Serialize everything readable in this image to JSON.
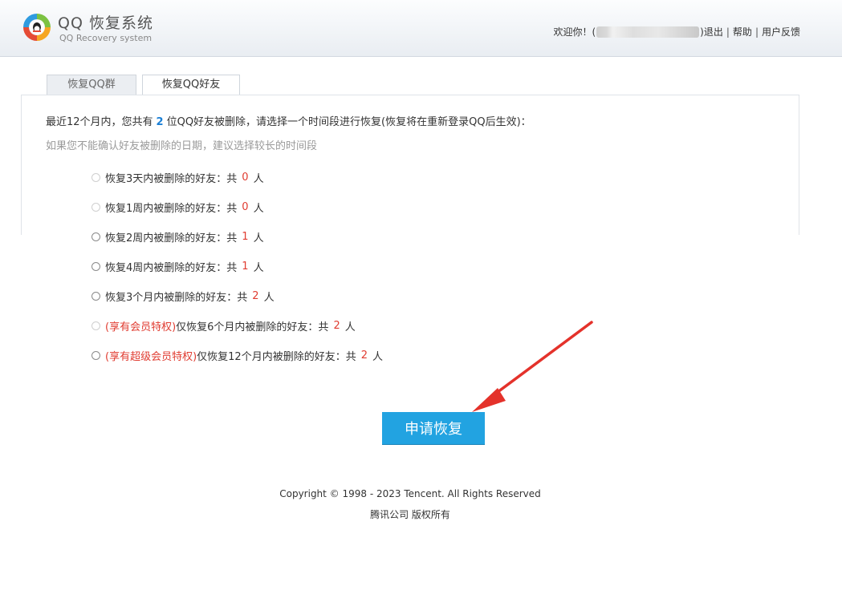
{
  "header": {
    "logo_title": "QQ 恢复系统",
    "logo_subtitle": "QQ Recovery system",
    "welcome": "欢迎你！(",
    "close_paren": ")",
    "logout": "退出",
    "help": "帮助",
    "feedback": "用户反馈",
    "sep": "|"
  },
  "tabs": [
    {
      "label": "恢复QQ群"
    },
    {
      "label": "恢复QQ好友"
    }
  ],
  "summary": {
    "prefix": "最近12个月内，您共有",
    "count": "2",
    "suffix": "位QQ好友被删除，请选择一个时间段进行恢复(恢复将在重新登录QQ后生效)："
  },
  "hint": "如果您不能确认好友被删除的日期，建议选择较长的时间段",
  "options": [
    {
      "vip": "",
      "label": "恢复3天内被删除的好友：共",
      "count": "0",
      "unit": "人"
    },
    {
      "vip": "",
      "label": "恢复1周内被删除的好友：共",
      "count": "0",
      "unit": "人"
    },
    {
      "vip": "",
      "label": "恢复2周内被删除的好友：共",
      "count": "1",
      "unit": "人"
    },
    {
      "vip": "",
      "label": "恢复4周内被删除的好友：共",
      "count": "1",
      "unit": "人"
    },
    {
      "vip": "",
      "label": "恢复3个月内被删除的好友：共",
      "count": "2",
      "unit": "人"
    },
    {
      "vip": "(享有会员特权)",
      "label": "仅恢复6个月内被删除的好友：共",
      "count": "2",
      "unit": "人"
    },
    {
      "vip": "(享有超级会员特权)",
      "label": "仅恢复12个月内被删除的好友：共",
      "count": "2",
      "unit": "人"
    }
  ],
  "apply_button": "申请恢复",
  "footer": {
    "copyright": "Copyright © 1998 - 2023 Tencent. All Rights Reserved",
    "company": "腾讯公司 版权所有"
  },
  "colors": {
    "accent_blue": "#22a3e1",
    "highlight_red": "#e03c31",
    "count_blue": "#1a7fd6"
  }
}
